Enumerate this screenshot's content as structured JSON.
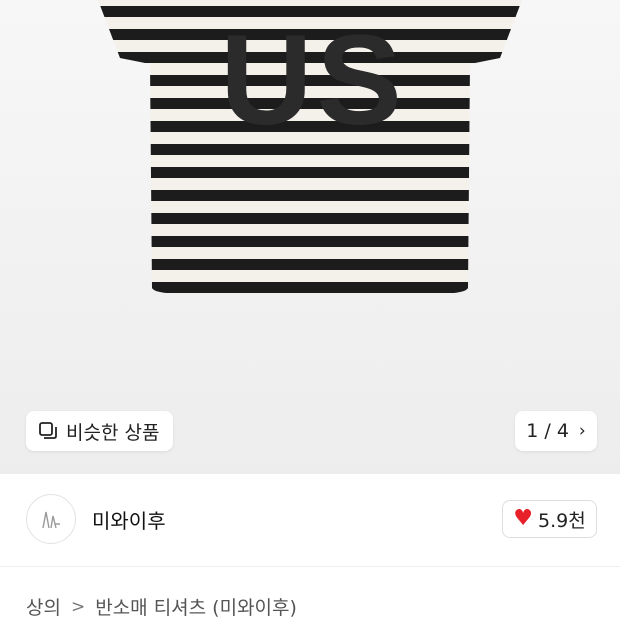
{
  "product_image": {
    "print_text": "US",
    "stripe_colors": [
      "#1c1c1c",
      "#f4f1ea"
    ]
  },
  "similar_button": {
    "label": "비슷한 상품",
    "icon": "similar-items-icon"
  },
  "image_counter": {
    "text": "1 / 4",
    "icon": "chevron-right-icon"
  },
  "seller": {
    "name": "미와이후",
    "avatar_icon": "shop-logo-icon"
  },
  "like_button": {
    "count": "5.9천",
    "icon": "heart-icon",
    "color": "#e8202a"
  },
  "breadcrumb": {
    "items": [
      "상의",
      "반소매 티셔츠 (미와이후)"
    ],
    "separator": ">"
  }
}
